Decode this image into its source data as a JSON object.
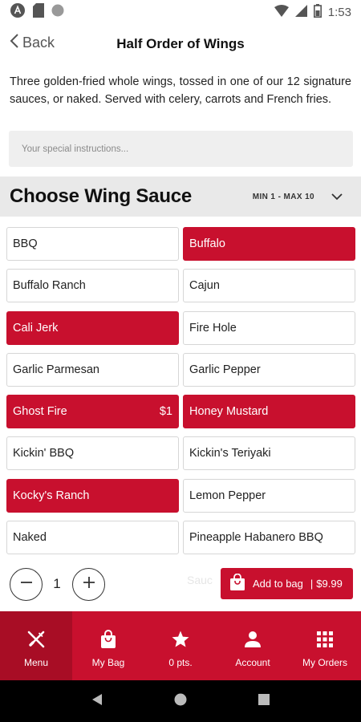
{
  "status_bar": {
    "time": "1:53"
  },
  "header": {
    "back_label": "Back",
    "title": "Half Order of Wings"
  },
  "description": "Three golden-fried whole wings, tossed in one of our 12 signature sauces, or naked. Served with celery, carrots and French fries.",
  "instructions": {
    "placeholder": "Your special instructions..."
  },
  "section": {
    "title": "Choose Wing Sauce",
    "limit": "MIN 1 - MAX 10"
  },
  "sauces": [
    {
      "label": "BBQ",
      "selected": false
    },
    {
      "label": "Buffalo",
      "selected": true
    },
    {
      "label": "Buffalo Ranch",
      "selected": false
    },
    {
      "label": "Cajun",
      "selected": false
    },
    {
      "label": "Cali Jerk",
      "selected": true
    },
    {
      "label": "Fire Hole",
      "selected": false
    },
    {
      "label": "Garlic Parmesan",
      "selected": false
    },
    {
      "label": "Garlic Pepper",
      "selected": false
    },
    {
      "label": "Ghost Fire",
      "selected": true,
      "price": "$1"
    },
    {
      "label": "Honey Mustard",
      "selected": true
    },
    {
      "label": "Kickin' BBQ",
      "selected": false
    },
    {
      "label": "Kickin's Teriyaki",
      "selected": false
    },
    {
      "label": "Kocky's Ranch",
      "selected": true
    },
    {
      "label": "Lemon Pepper",
      "selected": false
    },
    {
      "label": "Naked",
      "selected": false
    },
    {
      "label": "Pineapple Habanero BBQ",
      "selected": false
    }
  ],
  "footer": {
    "quantity": "1",
    "ghost_text": "Sauc",
    "add_label": "Add to bag",
    "add_separator": "|",
    "add_price": "$9.99"
  },
  "tabs": [
    {
      "label": "Menu",
      "icon": "fork-knife-icon",
      "active": true
    },
    {
      "label": "My Bag",
      "icon": "bag-icon",
      "active": false
    },
    {
      "label": "0 pts.",
      "icon": "star-icon",
      "active": false
    },
    {
      "label": "Account",
      "icon": "person-icon",
      "active": false
    },
    {
      "label": "My Orders",
      "icon": "grid-icon",
      "active": false
    }
  ],
  "colors": {
    "brand": "#c8102e",
    "brand_dark": "#a80d25",
    "section_bg": "#e9e9e9"
  }
}
